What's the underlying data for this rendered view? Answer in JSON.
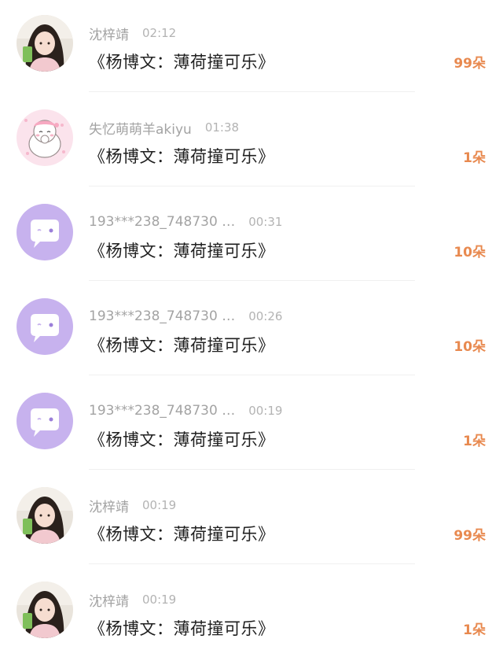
{
  "colors": {
    "accent": "#e8894f",
    "name_text": "#a3a3a3",
    "message_text": "#1f1f1f",
    "divider": "#f0f0f0",
    "bot_avatar_bg": "#c7b2ee"
  },
  "gifts": [
    {
      "avatar": "photo-girl-avatar",
      "name": "沈梓靖",
      "time": "02:12",
      "message": "《杨博文：薄荷撞可乐》",
      "count": "99朵"
    },
    {
      "avatar": "pink-cat-avatar",
      "name": "失忆萌萌羊akiyu",
      "time": "01:38",
      "message": "《杨博文：薄荷撞可乐》",
      "count": "1朵"
    },
    {
      "avatar": "chat-bubble-avatar",
      "name": "193***238_748730 …",
      "time": "00:31",
      "message": "《杨博文：薄荷撞可乐》",
      "count": "10朵"
    },
    {
      "avatar": "chat-bubble-avatar",
      "name": "193***238_748730 …",
      "time": "00:26",
      "message": "《杨博文：薄荷撞可乐》",
      "count": "10朵"
    },
    {
      "avatar": "chat-bubble-avatar",
      "name": "193***238_748730 …",
      "time": "00:19",
      "message": "《杨博文：薄荷撞可乐》",
      "count": "1朵"
    },
    {
      "avatar": "photo-girl-avatar",
      "name": "沈梓靖",
      "time": "00:19",
      "message": "《杨博文：薄荷撞可乐》",
      "count": "99朵"
    },
    {
      "avatar": "photo-girl-avatar",
      "name": "沈梓靖",
      "time": "00:19",
      "message": "《杨博文：薄荷撞可乐》",
      "count": "1朵"
    }
  ]
}
